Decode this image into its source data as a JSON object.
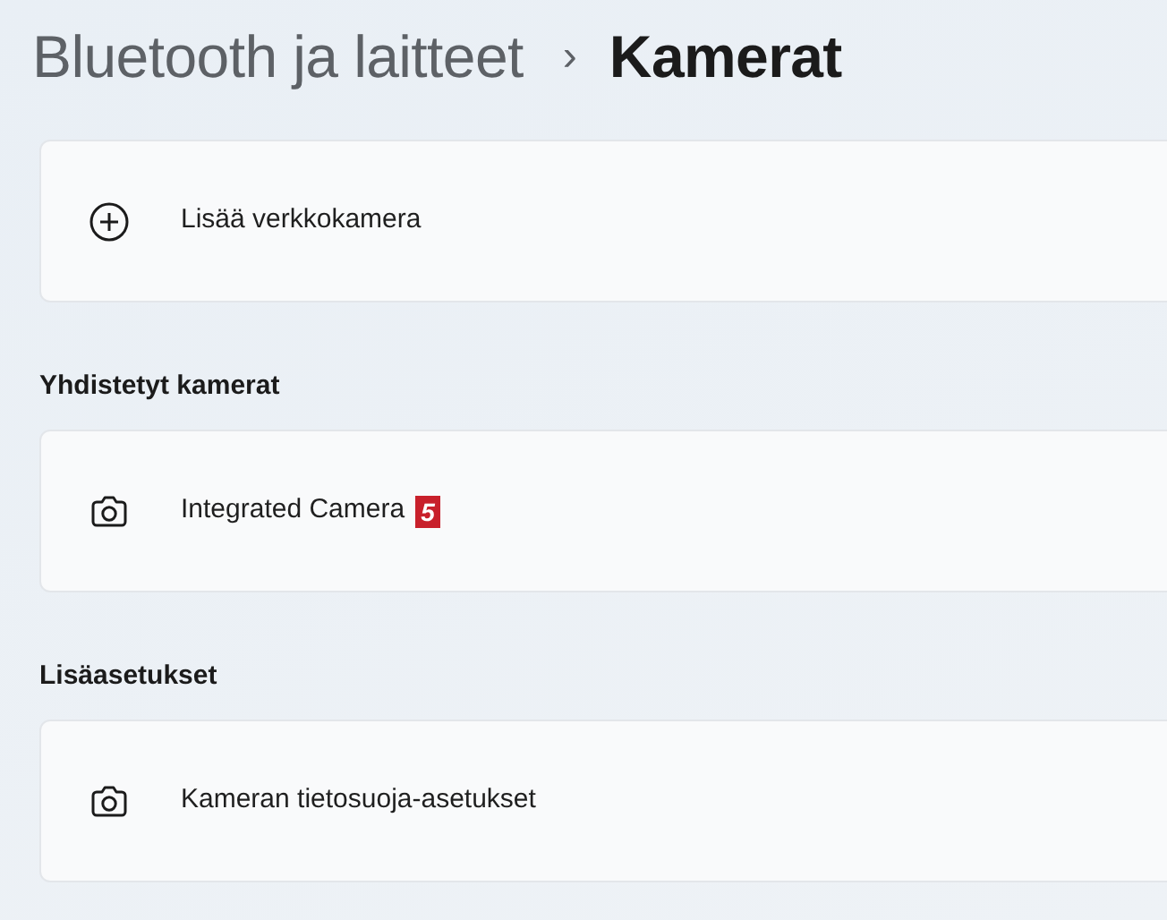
{
  "breadcrumb": {
    "parent": "Bluetooth ja laitteet",
    "separator": "›",
    "current": "Kamerat"
  },
  "sections": [
    {
      "items": [
        {
          "kind": "add",
          "label": "Lisää verkkokamera"
        }
      ]
    },
    {
      "heading": "Yhdistetyt kamerat",
      "items": [
        {
          "kind": "camera",
          "label": "Integrated Camera",
          "badge": "5"
        }
      ]
    },
    {
      "heading": "Lisäasetukset",
      "items": [
        {
          "kind": "camera",
          "label": "Kameran tietosuoja-asetukset"
        }
      ]
    }
  ]
}
